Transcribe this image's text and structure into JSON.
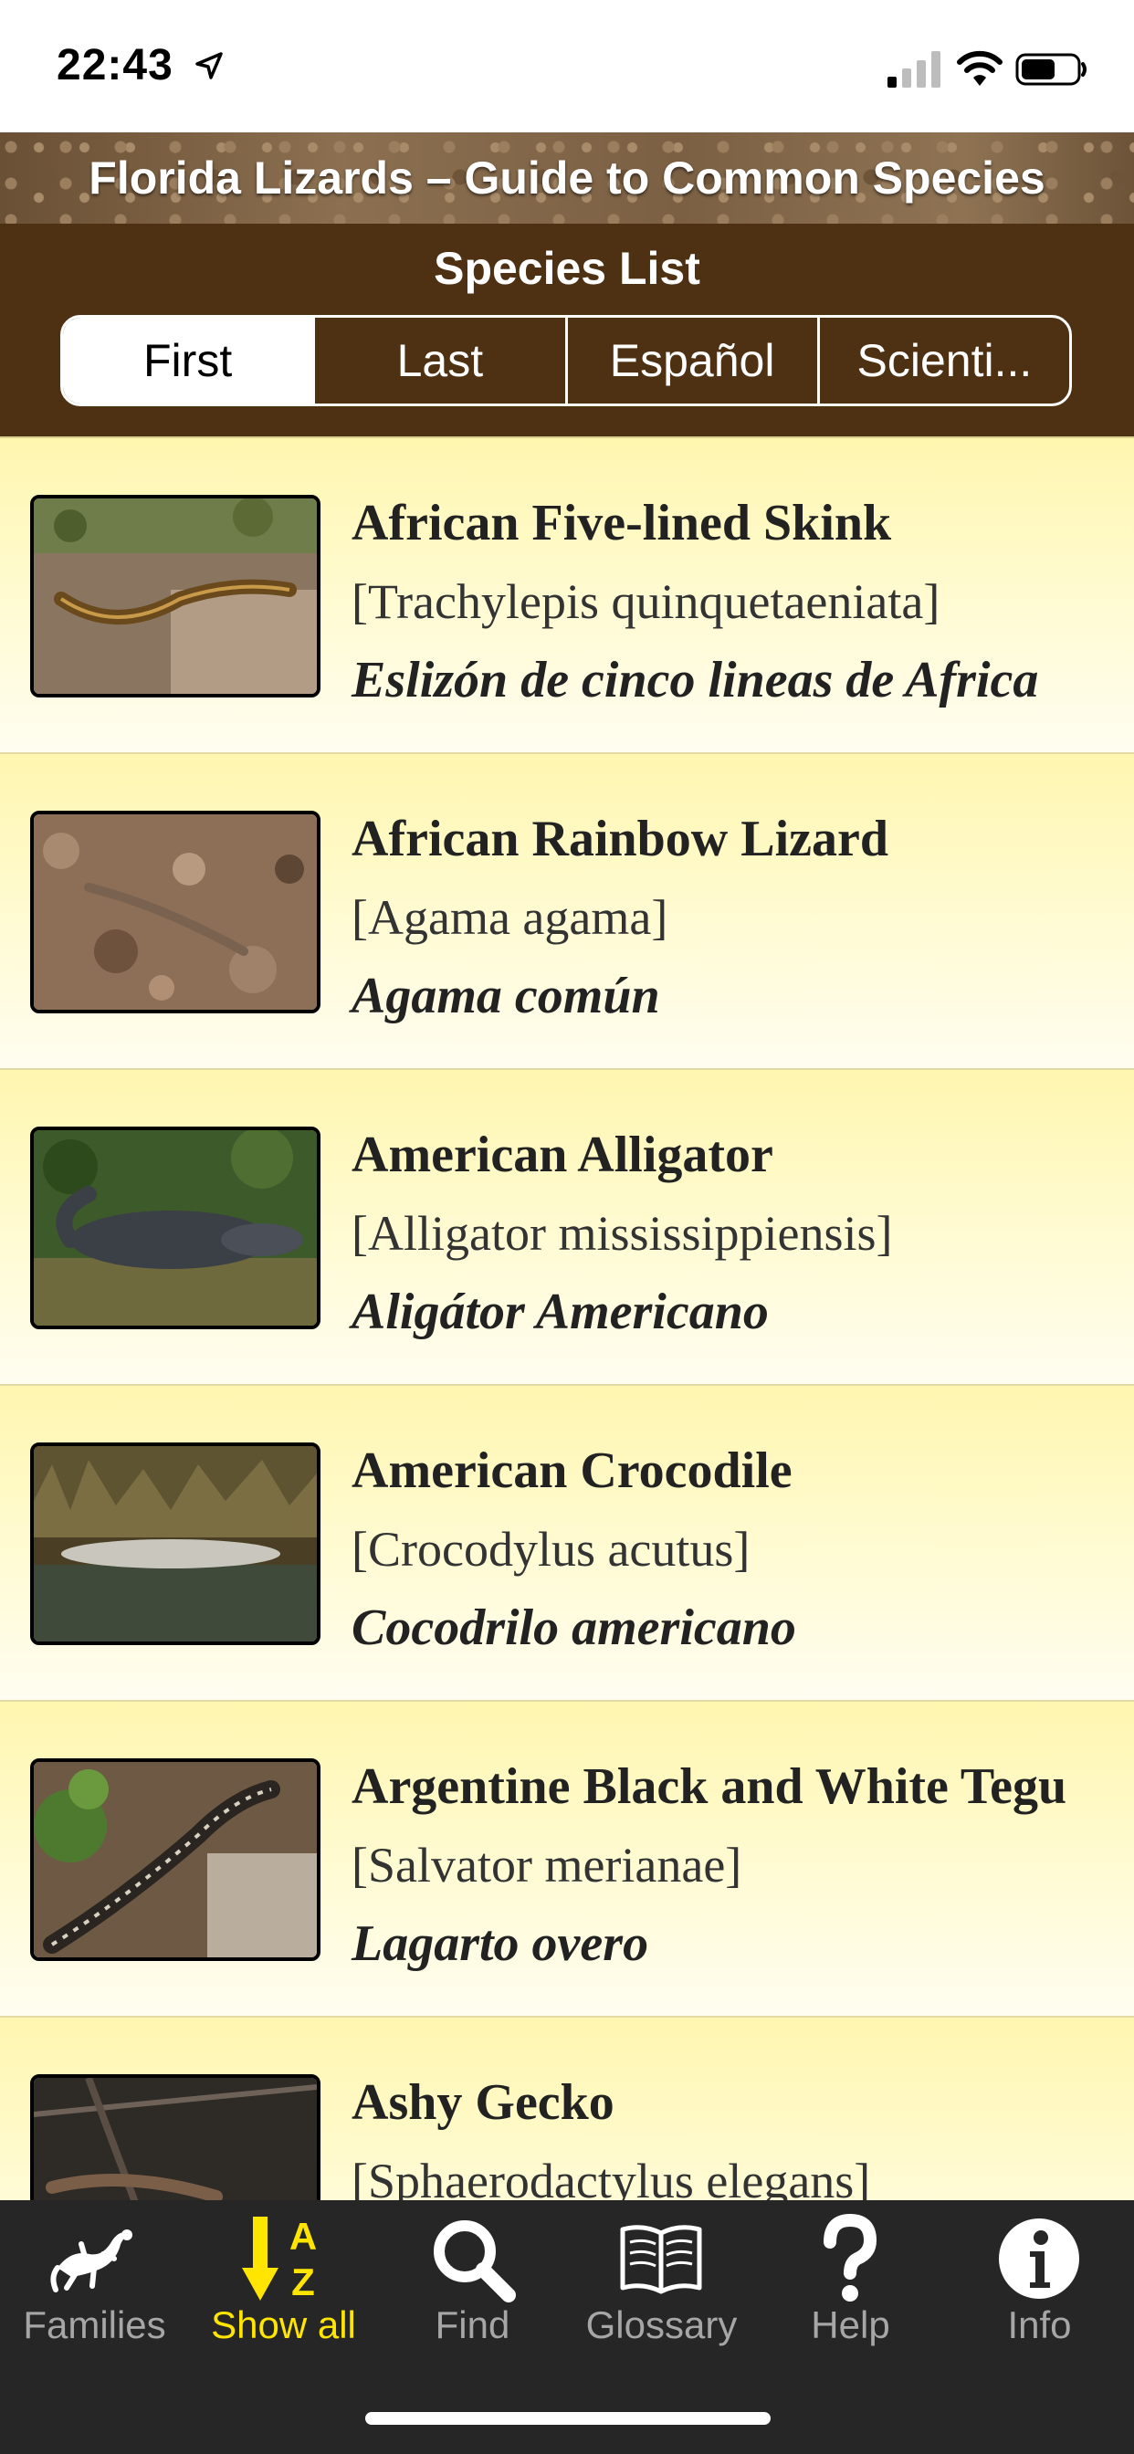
{
  "status_bar": {
    "time": "22:43",
    "icons": [
      "location-arrow-icon",
      "cellular-signal-icon",
      "wifi-icon",
      "battery-icon"
    ]
  },
  "app": {
    "title": "Florida Lizards – Guide to Common Species"
  },
  "header": {
    "title": "Species List",
    "segments": [
      {
        "label": "First",
        "selected": true
      },
      {
        "label": "Last",
        "selected": false
      },
      {
        "label": "Español",
        "selected": false
      },
      {
        "label": "Scienti...",
        "selected": false
      }
    ]
  },
  "species": [
    {
      "common": "African Five-lined Skink",
      "scientific": "[Trachylepis quinquetaeniata]",
      "spanish": "Eslizón de cinco lineas de Africa"
    },
    {
      "common": "African Rainbow Lizard",
      "scientific": "[Agama agama]",
      "spanish": "Agama común"
    },
    {
      "common": "American Alligator",
      "scientific": "[Alligator mississippiensis]",
      "spanish": "Aligátor Americano"
    },
    {
      "common": "American Crocodile",
      "scientific": "[Crocodylus acutus]",
      "spanish": "Cocodrilo americano"
    },
    {
      "common": "Argentine Black and White Tegu",
      "scientific": "[Salvator merianae]",
      "spanish": "Lagarto overo"
    },
    {
      "common": "Ashy Gecko",
      "scientific": "[Sphaerodactylus elegans]",
      "spanish": ""
    }
  ],
  "tabbar": {
    "items": [
      {
        "label": "Families",
        "icon": "gecko-icon",
        "active": false
      },
      {
        "label": "Show all",
        "icon": "sort-az-icon",
        "active": true
      },
      {
        "label": "Find",
        "icon": "magnifier-icon",
        "active": false
      },
      {
        "label": "Glossary",
        "icon": "book-icon",
        "active": false
      },
      {
        "label": "Help",
        "icon": "question-mark-icon",
        "active": false
      },
      {
        "label": "Info",
        "icon": "info-icon",
        "active": false
      }
    ],
    "active_color": "#ffe500",
    "inactive_color": "#a6a6a6"
  },
  "colors": {
    "header_bg": "#4e3113",
    "row_bg": "#fff6b0",
    "tabbar_bg": "#262626"
  }
}
